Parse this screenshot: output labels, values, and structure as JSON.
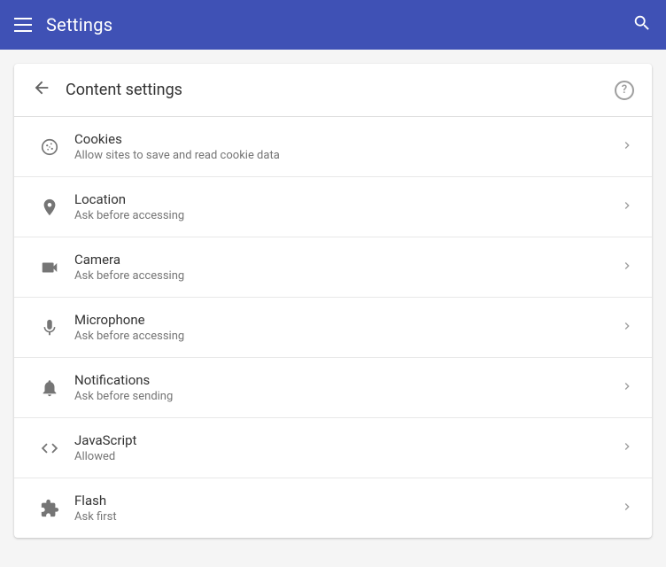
{
  "header": {
    "title": "Settings",
    "search_label": "Search"
  },
  "subheader": {
    "title": "Content settings",
    "back_label": "Back",
    "help_label": "Help"
  },
  "settings": {
    "items": [
      {
        "id": "cookies",
        "title": "Cookies",
        "subtitle": "Allow sites to save and read cookie data",
        "icon": "cookies"
      },
      {
        "id": "location",
        "title": "Location",
        "subtitle": "Ask before accessing",
        "icon": "location"
      },
      {
        "id": "camera",
        "title": "Camera",
        "subtitle": "Ask before accessing",
        "icon": "camera"
      },
      {
        "id": "microphone",
        "title": "Microphone",
        "subtitle": "Ask before accessing",
        "icon": "microphone"
      },
      {
        "id": "notifications",
        "title": "Notifications",
        "subtitle": "Ask before sending",
        "icon": "notifications"
      },
      {
        "id": "javascript",
        "title": "JavaScript",
        "subtitle": "Allowed",
        "icon": "javascript"
      },
      {
        "id": "flash",
        "title": "Flash",
        "subtitle": "Ask first",
        "icon": "flash"
      }
    ]
  }
}
